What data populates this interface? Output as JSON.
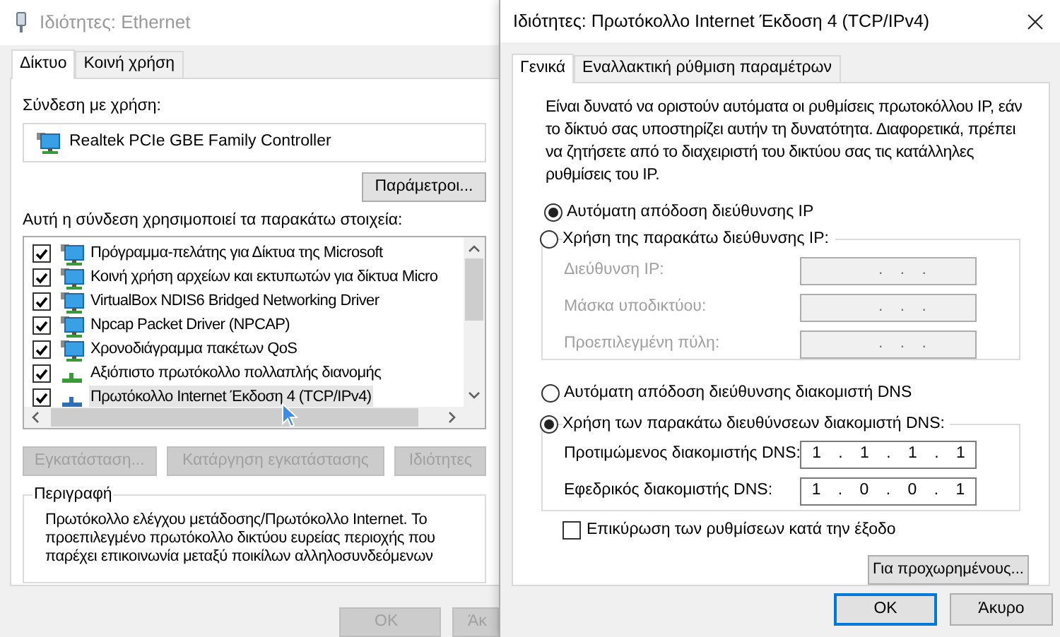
{
  "ethernet_window": {
    "title": "Ιδιότητες: Ethernet",
    "tabs": [
      {
        "label": "Δίκτυο",
        "selected": true
      },
      {
        "label": "Κοινή χρήση",
        "selected": false
      }
    ],
    "connect_label": "Σύνδεση με χρήση:",
    "adapter": "Realtek PCIe GBE Family Controller",
    "configure_button": "Παράμετροι...",
    "items_label": "Αυτή η σύνδεση χρησιμοποιεί τα παρακάτω στοιχεία:",
    "items": [
      {
        "label": "Πρόγραμμα-πελάτης για Δίκτυα της Microsoft",
        "checked": true,
        "selected": false,
        "kind": "client"
      },
      {
        "label": "Κοινή χρήση αρχείων και εκτυπωτών για δίκτυα Micro",
        "checked": true,
        "selected": false,
        "kind": "client"
      },
      {
        "label": "VirtualBox NDIS6 Bridged Networking Driver",
        "checked": true,
        "selected": false,
        "kind": "client"
      },
      {
        "label": "Npcap Packet Driver (NPCAP)",
        "checked": true,
        "selected": false,
        "kind": "client"
      },
      {
        "label": "Χρονοδιάγραμμα πακέτων QoS",
        "checked": true,
        "selected": false,
        "kind": "client"
      },
      {
        "label": "Αξιόπιστο πρωτόκολλο πολλαπλής διανομής",
        "checked": true,
        "selected": false,
        "kind": "protocol",
        "color": "#3a9a3a"
      },
      {
        "label": "Πρωτόκολλο Internet Έκδοση 4 (TCP/IPv4)",
        "checked": true,
        "selected": true,
        "kind": "protocol",
        "color": "#2f6fb3"
      }
    ],
    "buttons": [
      {
        "label": "Εγκατάσταση...",
        "disabled": true
      },
      {
        "label": "Κατάργηση εγκατάστασης",
        "disabled": true
      },
      {
        "label": "Ιδιότητες",
        "disabled": true
      }
    ],
    "description": {
      "title": "Περιγραφή",
      "lines": [
        "Πρωτόκολλο ελέγχου μετάδοσης/Πρωτόκολλο Internet. Το",
        "προεπιλεγμένο πρωτόκολλο δικτύου ευρείας περιοχής που",
        "παρέχει επικοινωνία μεταξύ ποικίλων αλληλοσυνδεόμενων"
      ]
    },
    "footer_buttons": [
      {
        "label": "OK",
        "disabled": true
      },
      {
        "label": "Άκ",
        "disabled": true
      }
    ]
  },
  "ipv4_dialog": {
    "title": "Ιδιότητες: Πρωτόκολλο Internet Έκδοση 4 (TCP/IPv4)",
    "tabs": [
      {
        "label": "Γενικά",
        "selected": true
      },
      {
        "label": "Εναλλακτική ρύθμιση παραμέτρων",
        "selected": false
      }
    ],
    "intro": [
      "Είναι δυνατό να οριστούν αυτόματα οι ρυθμίσεις πρωτοκόλλου IP, εάν",
      "το δίκτυό σας υποστηρίζει αυτήν τη δυνατότητα. Διαφορετικά, πρέπει",
      "να ζητήσετε από το διαχειριστή του δικτύου σας τις κατάλληλες",
      "ρυθμίσεις του IP."
    ],
    "ip_options": [
      {
        "label": "Αυτόματη απόδοση διεύθυνσης IP",
        "selected": true
      },
      {
        "label": "Χρήση της παρακάτω διεύθυνσης IP:",
        "selected": false
      }
    ],
    "ip_fields": [
      {
        "label": "Διεύθυνση IP:",
        "value": ". . .",
        "disabled": true
      },
      {
        "label": "Μάσκα υποδικτύου:",
        "value": ". . .",
        "disabled": true
      },
      {
        "label": "Προεπιλεγμένη πύλη:",
        "value": ". . .",
        "disabled": true
      }
    ],
    "dns_options": [
      {
        "label": "Αυτόματη απόδοση διεύθυνσης διακομιστή DNS",
        "selected": false
      },
      {
        "label": "Χρήση των παρακάτω διευθύνσεων διακομιστή DNS:",
        "selected": true
      }
    ],
    "dns_fields": [
      {
        "label": "Προτιμώμενος διακομιστής DNS:",
        "value": "1 . 1 . 1 . 1",
        "disabled": false
      },
      {
        "label": "Εφεδρικός διακομιστής DNS:",
        "value": "1 . 0 . 0 . 1",
        "disabled": false
      }
    ],
    "validate": {
      "label": "Επικύρωση των ρυθμίσεων κατά την έξοδο",
      "checked": false
    },
    "advanced_button": "Για προχωρημένους...",
    "footer_buttons": [
      {
        "label": "OK",
        "default": true
      },
      {
        "label": "Άκυρο",
        "default": false
      }
    ]
  }
}
